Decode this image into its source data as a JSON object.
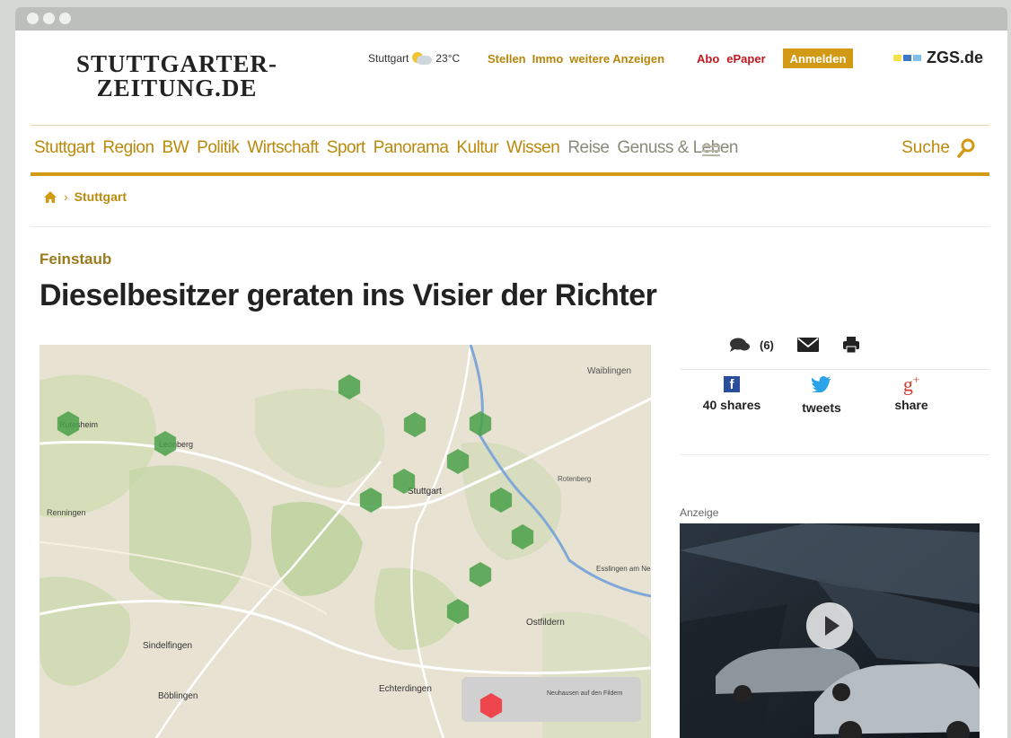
{
  "header": {
    "logo_line1": "STUTTGARTER-",
    "logo_line2": "ZEITUNG.DE",
    "weather_city": "Stuttgart",
    "weather_temp": "23°C",
    "weather_icon": "partly-cloudy-icon",
    "top_links": [
      "Stellen",
      "Immo",
      "weitere Anzeigen"
    ],
    "abo_links": [
      "Abo",
      "ePaper"
    ],
    "login_label": "Anmelden",
    "partner_logo": "ZGS.de"
  },
  "nav": {
    "items": [
      "Stuttgart",
      "Region",
      "BW",
      "Politik",
      "Wirtschaft",
      "Sport",
      "Panorama",
      "Kultur",
      "Wissen",
      "Reise",
      "Genuss & Leben"
    ],
    "search_label": "Suche"
  },
  "breadcrumb": {
    "current": "Stuttgart"
  },
  "article": {
    "kicker": "Feinstaub",
    "headline": "Dieselbesitzer geraten ins Visier der Richter"
  },
  "map": {
    "labels": [
      {
        "text": "Waiblingen"
      },
      {
        "text": "Rutesheim"
      },
      {
        "text": "Leonberg"
      },
      {
        "text": "Stuttgart"
      },
      {
        "text": "Renningen"
      },
      {
        "text": "Rotenberg"
      },
      {
        "text": "Esslingen am Neckar"
      },
      {
        "text": "Ostfildern"
      },
      {
        "text": "Sindelfingen"
      },
      {
        "text": "Böblingen"
      },
      {
        "text": "Echterdingen"
      },
      {
        "text": "Neuhausen auf den Fildern"
      }
    ]
  },
  "sidebar": {
    "comment_count": "(6)",
    "fb_label": "40 shares",
    "tw_label": "tweets",
    "gp_label": "share",
    "ad_label": "Anzeige"
  },
  "colors": {
    "accent": "#d29a14",
    "nav_text": "#b98a0c",
    "red": "#c0181e",
    "hex_green": "#4aa04a",
    "hex_red": "#ef3e45"
  }
}
